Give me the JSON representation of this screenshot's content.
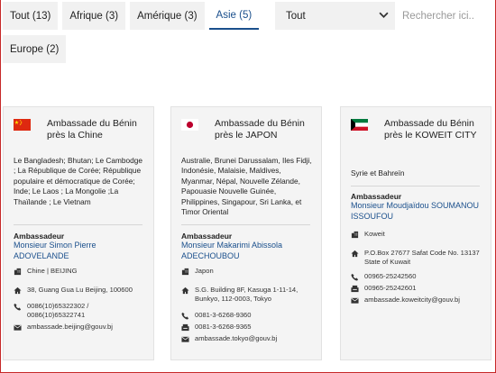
{
  "tabs": [
    {
      "label": "Tout (13)"
    },
    {
      "label": "Afrique (3)"
    },
    {
      "label": "Amérique (3)"
    },
    {
      "label": "Asie (5)"
    },
    {
      "label": "Europe (2)"
    }
  ],
  "filter": {
    "value": "Tout"
  },
  "search": {
    "placeholder": "Rechercher ici.."
  },
  "colors": {
    "accent": "#1a4f8c",
    "frame": "#c62828"
  },
  "cards": [
    {
      "title": "Ambassade du Bénin près la Chine",
      "flag": "china-flag",
      "countries": "Le Bangladesh; Bhutan; Le Cambodge ; La République de Corée; République populaire et démocratique de Corée; Inde; Le Laos ; La Mongolie ;La Thaïlande ; Le Vietnam",
      "amb_label": "Ambassadeur",
      "amb_name": "Monsieur Simon Pierre ADOVELANDE",
      "city": "Chine | BEIJING",
      "address": "38, Guang Gua Lu Beijing, 100600",
      "phone": "0086(10)65322302 / 0086(10)65322741",
      "email": "ambassade.beijing@gouv.bj"
    },
    {
      "title": "Ambassade du Bénin près le JAPON",
      "flag": "japan-flag",
      "countries": "Australie, Brunei Darussalam, Iles Fidji, Indonésie, Malaisie, Maldives, Myanmar, Népal, Nouvelle Zélande, Papouasie Nouvelle Guinée, Philippines, Singapour, Sri Lanka, et Timor Oriental",
      "amb_label": "Ambassadeur",
      "amb_name": "Monsieur Makarimi Abissola ADECHOUBOU",
      "city": "Japon",
      "address": "S.G. Building 8F, Kasuga 1-11-14, Bunkyo, 112-0003, Tokyo",
      "phone": "0081-3-6268-9360",
      "fax": "0081-3-6268-9365",
      "email": "ambassade.tokyo@gouv.bj"
    },
    {
      "title": "Ambassade du Bénin près le KOWEIT CITY",
      "flag": "kuwait-flag",
      "countries": "Syrie et Bahreïn",
      "amb_label": "Ambassadeur",
      "amb_name": "Monsieur Moudjaïdou SOUMANOU ISSOUFOU",
      "city": "Koweit",
      "address": "P.O.Box 27677 Safat Code No. 13137 State of Kuwait",
      "phone": "00965-25242560",
      "fax": "00965-25242601",
      "email": "ambassade.koweitcity@gouv.bj"
    }
  ]
}
